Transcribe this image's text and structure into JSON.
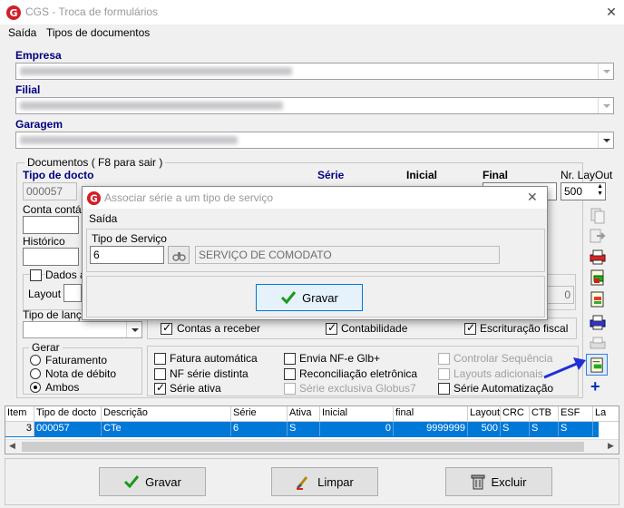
{
  "window": {
    "title": "CGS - Troca de formulários",
    "close": "✕"
  },
  "menu": [
    "Saída",
    "Tipos de documentos"
  ],
  "empresa": {
    "label": "Empresa"
  },
  "filial": {
    "label": "Filial"
  },
  "garagem": {
    "label": "Garagem"
  },
  "documentos": {
    "legend": "Documentos ( F8 para sair )",
    "tipo_docto_label": "Tipo de docto",
    "tipo_docto_value": "000057",
    "serie_label": "Série",
    "inicial_label": "Inicial",
    "final_label": "Final",
    "nr_layout_label": "Nr. LayOut",
    "nr_layout_value": "500",
    "conta_contabil_label": "Conta contáb",
    "historico_label": "Histórico",
    "dados_label": "Dados a",
    "layout_label": "Layout",
    "layout_num": "0",
    "tipo_lanc_label": "Tipo de lança",
    "contas_receber": "Contas a receber",
    "contabilidade": "Contabilidade",
    "escrituracao": "Escrituração fiscal"
  },
  "gerar": {
    "legend": "Gerar",
    "options": [
      "Faturamento",
      "Nota de débito",
      "Ambos"
    ],
    "selected": 2
  },
  "checks": {
    "fatura_automatica": "Fatura automática",
    "nf_serie_distinta": "NF série distinta",
    "serie_ativa": "Série ativa",
    "envia_nfe": "Envia NF-e Glb+",
    "reconciliacao": "Reconciliação eletrônica",
    "serie_exclusiva": "Série exclusiva Globus7",
    "controlar_sequencia": "Controlar Sequência",
    "layouts_adicionais": "Layouts adicionais",
    "serie_automatizacao": "Série Automatização"
  },
  "grid": {
    "headers": [
      "Item",
      "Tipo de docto",
      "Descrição",
      "Série",
      "Ativa",
      "Inicial",
      "final",
      "Layout",
      "CRC",
      "CTB",
      "ESF",
      "La"
    ],
    "rows": [
      [
        "3",
        "000057",
        "CTe",
        "6",
        "S",
        "0",
        "9999999",
        "500",
        "S",
        "S",
        "S",
        ""
      ]
    ]
  },
  "buttons": {
    "gravar": "Gravar",
    "limpar": "Limpar",
    "excluir": "Excluir"
  },
  "dialog": {
    "title": "Associar série a um tipo de serviço",
    "menu": "Saída",
    "tipo_servico_label": "Tipo de Serviço",
    "tipo_servico_value": "6",
    "descricao_value": "SERVIÇO DE COMODATO",
    "gravar": "Gravar"
  },
  "colors": {
    "accent": "#0078d7",
    "label_blue": "#000080",
    "arrow": "#1f2fd6"
  }
}
